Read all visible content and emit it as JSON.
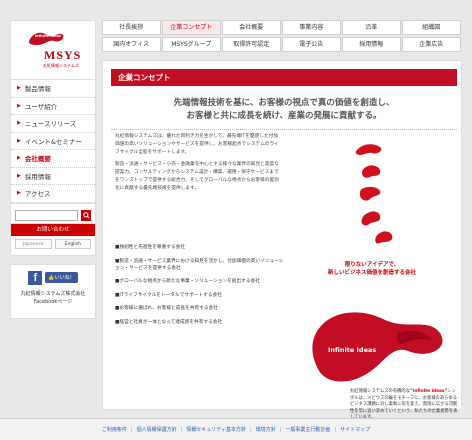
{
  "logo": {
    "mark_text": "Infinite Ideas",
    "name": "MSYS",
    "sub": "丸紅情報システムズ"
  },
  "sidebar": {
    "items": [
      {
        "label": "製品情報",
        "active": false
      },
      {
        "label": "ユーザ紹介",
        "active": false
      },
      {
        "label": "ニュースリリース",
        "active": false
      },
      {
        "label": "イベント&セミナー",
        "active": false
      },
      {
        "label": "会社概要",
        "active": true
      },
      {
        "label": "採用情報",
        "active": false
      },
      {
        "label": "アクセス",
        "active": false
      }
    ],
    "contact_label": "お問い合わせ",
    "lang_ja": "Japanese",
    "lang_en": "English",
    "facebook": {
      "like": "いいね！",
      "text_line1": "丸紅情報システムズ株式会社",
      "text_line2": "Facebookページ"
    }
  },
  "tabs": {
    "row1": [
      {
        "label": "社長挨拶",
        "active": false
      },
      {
        "label": "企業コンセプト",
        "active": true
      },
      {
        "label": "会社概要",
        "active": false
      },
      {
        "label": "事業内容",
        "active": false
      },
      {
        "label": "沿革",
        "active": false
      },
      {
        "label": "組織図",
        "active": false
      }
    ],
    "row2": [
      {
        "label": "国内オフィス",
        "active": false
      },
      {
        "label": "MSYSグループ",
        "active": false
      },
      {
        "label": "取得許可認定",
        "active": false
      },
      {
        "label": "電子公告",
        "active": false
      },
      {
        "label": "採用情報",
        "active": false
      },
      {
        "label": "企業広告",
        "active": false
      }
    ]
  },
  "main": {
    "header": "企業コンセプト",
    "hero_line1": "先端情報技術を基に、お客様の視点で真の価値を創造し、",
    "hero_line2": "お客様と共に成長を続け、産業の発展に貢献する。",
    "para1": "丸紅情報システムズは、優れた目利き力を生かして、最先端ITを駆使した付加価値の高いソリューションやサービスを提供し、お客様起点でシステムのライフサイクル全般をサポートします。",
    "para2": "製造・流通・サービス・小売・金融業を中心とする様々な業界の知見と高度な提案力、コンサルティングからシステム設計・構築、運用・保守サービスまでをワンストップで提供する総合力、そしてグローバルな視点からお客様の差別化に貢献する最先端技術を提供します。",
    "bullets": [
      "■独創性と先進性を尊重する会社",
      "■製造・流通・サービス業界における知見を活かし、付加価値の高いソリューション・サービスを提供する会社",
      "■グローバルな視点から新たな事業・ソリューションを創出する会社",
      "■ITライフサイクルをトータルでサポートする会社",
      "■お客様に選ばれ、お客様と成長を共有する会社",
      "■経営と社員が一体となって達成感を共有する会社"
    ],
    "tagline1": "限りないアイデアで、",
    "tagline2": "新しいビジネス価値を創造する会社",
    "ii_text": "Infinite Ideas",
    "caption_pre": "丸紅情報システムズの有機的な",
    "caption_hl": "“infinite ideas”",
    "caption_post": "シンボルは、メビウスの輪をモチーフに、お客様のあらゆるビジネス課題に対し柔軟に形を変え、無限に広がる可能性を常に追い求めていくという、私たちの企業姿勢を表しています。"
  },
  "footer": {
    "links": [
      "ご利用条件",
      "個人情報保護方針",
      "情報セキュリティ基本方針",
      "環境方針",
      "一般事業主行動計画",
      "サイトマップ"
    ]
  },
  "colors": {
    "accent": "#c30d23",
    "link": "#2a5db0",
    "tab_active_bg": "#fde9e9"
  }
}
